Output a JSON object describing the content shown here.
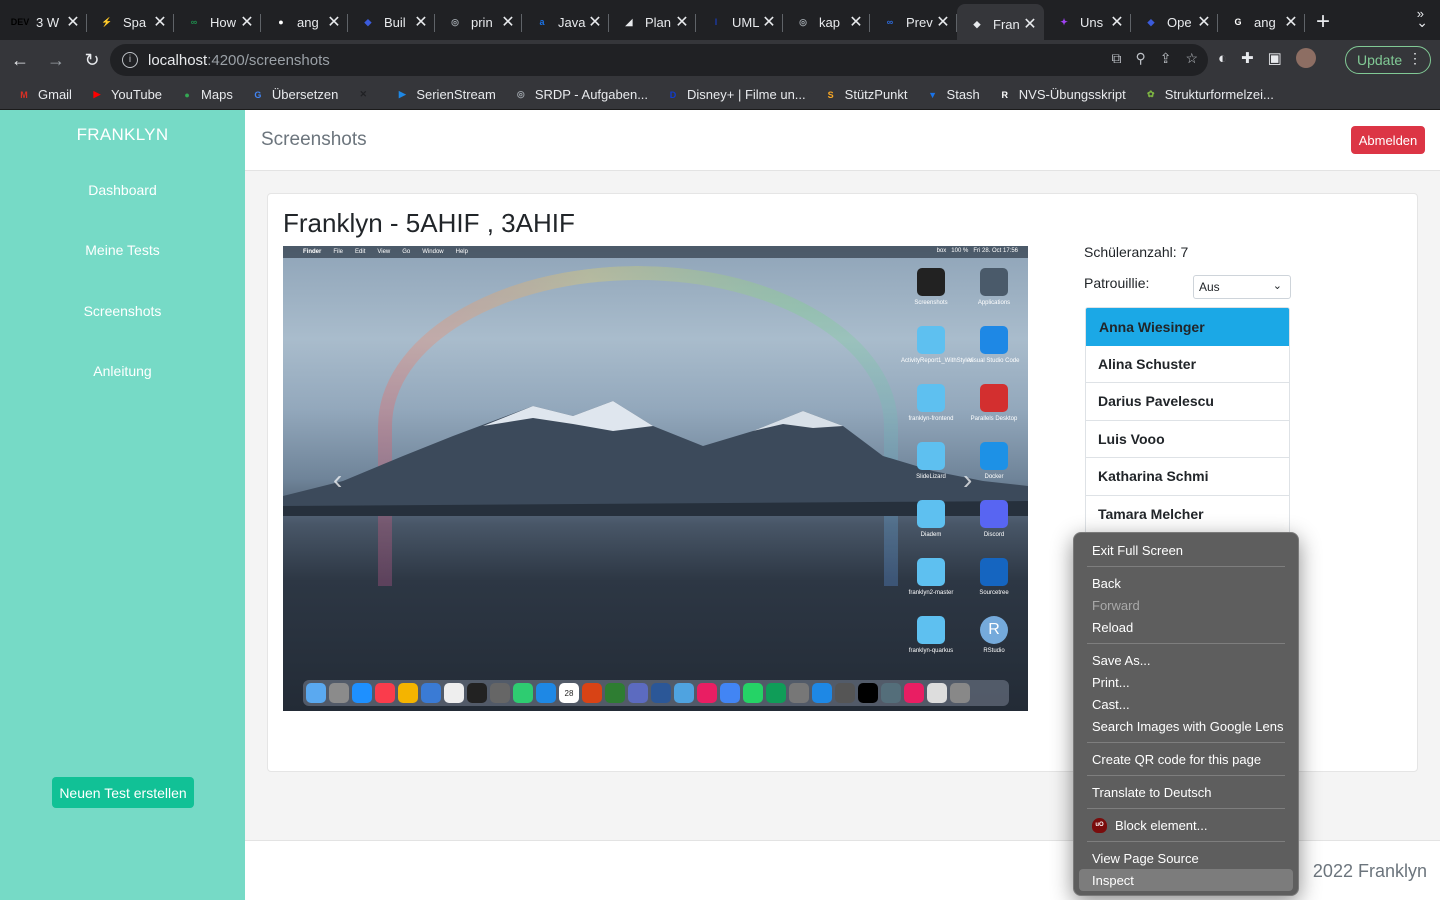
{
  "browser": {
    "tabs": [
      {
        "label": "3 W",
        "icon": "dev-icon",
        "color": "#000000",
        "glyph": "DEV"
      },
      {
        "label": "Spa",
        "icon": "spartan-icon",
        "color": "#5f6368",
        "glyph": "⚡"
      },
      {
        "label": "How",
        "icon": "codegrepper-icon",
        "color": "#1f8f4e",
        "glyph": "∞"
      },
      {
        "label": "ang",
        "icon": "github-icon",
        "color": "#ffffff",
        "glyph": "●"
      },
      {
        "label": "Buil",
        "icon": "app-icon",
        "color": "#3b5bdb",
        "glyph": "◆"
      },
      {
        "label": "prin",
        "icon": "globe-icon",
        "color": "#9aa0a6",
        "glyph": "◎"
      },
      {
        "label": "Java",
        "icon": "a-icon",
        "color": "#1a73e8",
        "glyph": "a"
      },
      {
        "label": "Plan",
        "icon": "plan-icon",
        "color": "#e8eaed",
        "glyph": "◢"
      },
      {
        "label": "UML",
        "icon": "uml-icon",
        "color": "#1a3aa8",
        "glyph": "I"
      },
      {
        "label": "kap",
        "icon": "globe-icon",
        "color": "#9aa0a6",
        "glyph": "◎"
      },
      {
        "label": "Prev",
        "icon": "preview-icon",
        "color": "#2d6cdf",
        "glyph": "∞"
      },
      {
        "label": "Fran",
        "icon": "graduation-cap-icon",
        "color": "#e8eaed",
        "glyph": "◆",
        "active": true
      },
      {
        "label": "Uns",
        "icon": "unsplash-icon",
        "color": "#a142f4",
        "glyph": "✦"
      },
      {
        "label": "Ope",
        "icon": "app-icon",
        "color": "#3b5bdb",
        "glyph": "◆"
      },
      {
        "label": "ang",
        "icon": "google-icon",
        "color": "#ffffff",
        "glyph": "G"
      }
    ],
    "new_tab": "+",
    "url_host": "localhost",
    "url_path": ":4200/screenshots",
    "update_label": "Update",
    "bookmarks": [
      {
        "label": "Gmail",
        "icon": "gmail-icon",
        "color": "#d93025",
        "glyph": "M"
      },
      {
        "label": "YouTube",
        "icon": "youtube-icon",
        "color": "#ff0000",
        "glyph": "▶"
      },
      {
        "label": "Maps",
        "icon": "maps-icon",
        "color": "#34a853",
        "glyph": "●"
      },
      {
        "label": "Übersetzen",
        "icon": "translate-icon",
        "color": "#4285f4",
        "glyph": "G"
      },
      {
        "label": "",
        "icon": "x-tools-icon",
        "color": "#202124",
        "glyph": "✕"
      },
      {
        "label": "SerienStream",
        "icon": "serienstream-icon",
        "color": "#1e88e5",
        "glyph": "▶"
      },
      {
        "label": "SRDP - Aufgaben...",
        "icon": "globe-icon",
        "color": "#9aa0a6",
        "glyph": "◎"
      },
      {
        "label": "Disney+ | Filme un...",
        "icon": "disney-icon",
        "color": "#113ccf",
        "glyph": "D"
      },
      {
        "label": "StützPunkt",
        "icon": "stuetzpunkt-icon",
        "color": "#f9a825",
        "glyph": "S"
      },
      {
        "label": "Stash",
        "icon": "stash-icon",
        "color": "#1a73e8",
        "glyph": "▼"
      },
      {
        "label": "NVS-Übungsskript",
        "icon": "nvs-icon",
        "color": "#ffffff",
        "glyph": "R"
      },
      {
        "label": "Strukturformelzei...",
        "icon": "molecule-icon",
        "color": "#7cb342",
        "glyph": "✿"
      }
    ],
    "more": "»"
  },
  "sidebar": {
    "brand": "FRANKLYN",
    "items": [
      "Dashboard",
      "Meine Tests",
      "Screenshots",
      "Anleitung"
    ],
    "new_test": "Neuen Test erstellen"
  },
  "header": {
    "title": "Screenshots",
    "logout": "Abmelden"
  },
  "card": {
    "title": "Franklyn - 5AHIF , 3AHIF",
    "student_count": "Schüleranzahl: 7",
    "patrol_label": "Patrouillie:",
    "patrol_value": "Aus",
    "students": [
      "Anna Wiesinger",
      "Alina Schuster",
      "Darius Pavelescu",
      "Luis Vooo",
      "Katharina Schmi",
      "Tamara Melcher"
    ],
    "selected_student": 0
  },
  "screenshot": {
    "menubar": [
      "Finder",
      "File",
      "Edit",
      "View",
      "Go",
      "Window",
      "Help"
    ],
    "clock": "Fri 28. Oct 17:56",
    "battery": "100 %",
    "box": "box",
    "desktop_icons": [
      {
        "label": "Screenshots",
        "kind": "screen"
      },
      {
        "label": "Applications",
        "kind": "apps"
      },
      {
        "label": "ActivityReport1_WithStyles",
        "kind": "folder"
      },
      {
        "label": "Visual Studio Code",
        "kind": "vscode"
      },
      {
        "label": "franklyn-frontend",
        "kind": "folder"
      },
      {
        "label": "Parallels Desktop",
        "kind": "parallels"
      },
      {
        "label": "SlideLizard",
        "kind": "folder"
      },
      {
        "label": "Docker",
        "kind": "docker"
      },
      {
        "label": "Diadem",
        "kind": "folder"
      },
      {
        "label": "Discord",
        "kind": "discord"
      },
      {
        "label": "franklyn2-master",
        "kind": "folder"
      },
      {
        "label": "Sourcetree",
        "kind": "sourcetree"
      },
      {
        "label": "franklyn-quarkus",
        "kind": "folder"
      },
      {
        "label": "RStudio",
        "kind": "rstudio"
      }
    ],
    "icon_letters": {
      "rstudio": "R"
    },
    "calendar_day": "28"
  },
  "footer": {
    "text": "2022 Franklyn"
  },
  "context_menu": {
    "groups": [
      [
        {
          "label": "Exit Full Screen"
        }
      ],
      [
        {
          "label": "Back"
        },
        {
          "label": "Forward",
          "disabled": true
        },
        {
          "label": "Reload"
        }
      ],
      [
        {
          "label": "Save As..."
        },
        {
          "label": "Print..."
        },
        {
          "label": "Cast..."
        },
        {
          "label": "Search Images with Google Lens"
        }
      ],
      [
        {
          "label": "Create QR code for this page"
        }
      ],
      [
        {
          "label": "Translate to Deutsch"
        }
      ],
      [
        {
          "label": "Block element...",
          "icon": "ublock-icon"
        }
      ],
      [
        {
          "label": "View Page Source"
        },
        {
          "label": "Inspect",
          "highlighted": true
        }
      ]
    ]
  }
}
